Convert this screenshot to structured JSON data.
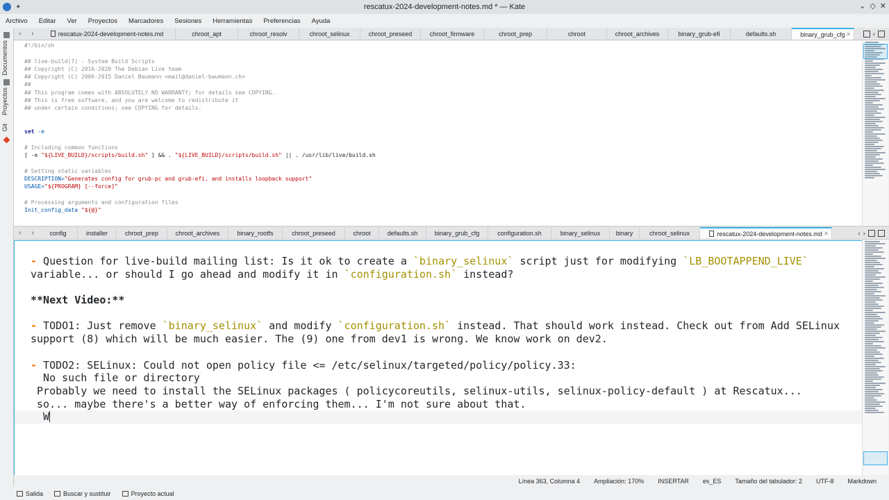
{
  "window": {
    "title": "rescatux-2024-development-notes.md * — Kate"
  },
  "menu": [
    "Archivo",
    "Editar",
    "Ver",
    "Proyectos",
    "Marcadores",
    "Sesiones",
    "Herramientas",
    "Preferencias",
    "Ayuda"
  ],
  "sidebar": {
    "documents": "Documentos",
    "projects": "Proyectos",
    "git": "Git"
  },
  "top_tabs": [
    "rescatux-2024-development-notes.md",
    "chroot_apt",
    "chroot_resolv",
    "chroot_selinux",
    "chroot_preseed",
    "chroot_firmware",
    "chroot_prep",
    "chroot",
    "chroot_archives",
    "binary_grub-efi",
    "defaults.sh",
    "binary_grub_cfg"
  ],
  "top_active": "binary_grub_cfg",
  "bottom_tabs": [
    "config",
    "installer",
    "chroot_prep",
    "chroot_archives",
    "binary_rootfs",
    "chroot_preseed",
    "chroot",
    "defaults.sh",
    "binary_grub_cfg",
    "configuration.sh",
    "binary_selinux",
    "binary",
    "chroot_selinux",
    "rescatux-2024-development-notes.md"
  ],
  "bottom_active": "rescatux-2024-development-notes.md",
  "top_code": {
    "l1": "#!/bin/sh",
    "l3": "## live-build(7) - System Build Scripts",
    "l4": "## Copyright (C) 2016-2020 The Debian Live team",
    "l5": "## Copyright (C) 2006-2015 Daniel Baumann <mail@daniel-baumann.ch>",
    "l6": "##",
    "l7": "## This program comes with ABSOLUTELY NO WARRANTY; for details see COPYING.",
    "l8": "## This is free software, and you are welcome to redistribute it",
    "l9": "## under certain conditions; see COPYING for details.",
    "l12_kw": "set",
    "l12_rest": " -e",
    "l14": "# Including common functions",
    "l15_a": "[ -e ",
    "l15_b": "\"${LIVE_BUILD}/scripts/build.sh\"",
    "l15_c": " ] && . ",
    "l15_d": "\"${LIVE_BUILD}/scripts/build.sh\"",
    "l15_e": " || . /usr/lib/live/build.sh",
    "l17": "# Setting static variables",
    "l18_a": "DESCRIPTION=",
    "l18_b": "\"Generates config for grub-pc and grub-efi, and installs loopback support\"",
    "l19_a": "USAGE=",
    "l19_b": "\"${PROGRAM} [--force]\"",
    "l21": "# Processing arguments and configuration files",
    "l22_a": "Init_config_data",
    "l22_b": " \"${@}\""
  },
  "notes": {
    "dash": "-",
    "q_a": " Question for live-build mailing list: Is it ok to create a ",
    "q_code1": "`binary_selinux`",
    "q_b": " script just for modifying ",
    "q_code2": "`LB_BOOTAPPEND_LIVE`",
    "q_c": "variable... or should I go ahead and modify it in ",
    "q_code3": "`configuration.sh`",
    "q_d": " instead?",
    "next_video": "**Next Video:**",
    "t1_a": " TODO1: Just remove ",
    "t1_code1": "`binary_selinux`",
    "t1_b": " and modify ",
    "t1_code2": "`configuration.sh`",
    "t1_c": " instead. That should work instead. Check out from Add SELinux",
    "t1_d": "support (8) which will be much easier. The (9) one from dev1 is wrong. We know work on dev2.",
    "t2_a": " TODO2: SELinux: Could not open policy file <= /etc/selinux/targeted/policy/policy.33:",
    "t2_b": "  No such file or directory",
    "t2_c": " Probably we need to install the SELinux packages ( policycoreutils, selinux-utils, selinux-policy-default ) at Rescatux...",
    "t2_d": " so... maybe there's a better way of enforcing them... I'm not sure about that.",
    "t2_e": "  W"
  },
  "status": {
    "position": "Línea 363, Columna 4",
    "zoom": "Ampliación: 170%",
    "mode": "INSERTAR",
    "language": "es_ES",
    "tab_size": "Tamaño del tabulador: 2",
    "encoding": "UTF-8",
    "syntax": "Markdown"
  },
  "bottom_panel": {
    "output": "Salida",
    "search": "Buscar y sustituir",
    "project": "Proyecto actual"
  }
}
